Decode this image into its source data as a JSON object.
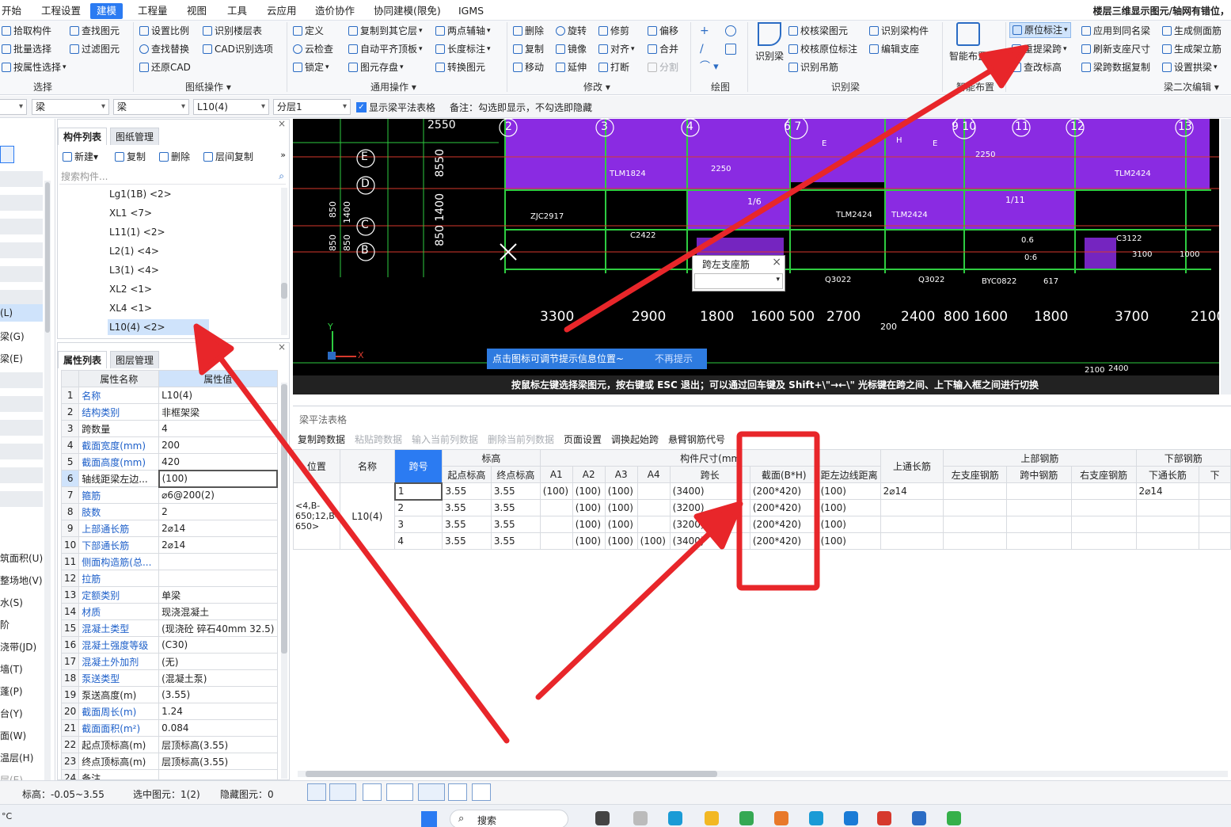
{
  "menu": {
    "items": [
      "开始",
      "工程设置",
      "建模",
      "工程量",
      "视图",
      "工具",
      "云应用",
      "造价协作",
      "协同建模(限免)",
      "IGMS"
    ],
    "active_index": 2,
    "right_info": "楼层三维显示图元/轴网有错位，"
  },
  "ribbon": {
    "select": {
      "items": [
        "拾取构件",
        "批量选择",
        "按属性选择"
      ],
      "items2": [
        "查找图元",
        "过滤图元"
      ],
      "group": "选择"
    },
    "drawing_ops": {
      "items": [
        "设置比例",
        "查找替换",
        "还原CAD"
      ],
      "items2": [
        "识别楼层表",
        "CAD识别选项"
      ],
      "group": "图纸操作"
    },
    "common_ops": {
      "items": [
        "定义",
        "云检查",
        "锁定"
      ],
      "items2": [
        "复制到其它层",
        "自动平齐顶板",
        "图元存盘"
      ],
      "items3": [
        "两点辅轴",
        "长度标注",
        "转换图元"
      ],
      "group": "通用操作"
    },
    "modify": {
      "items": [
        "删除",
        "复制",
        "移动"
      ],
      "items2": [
        "旋转",
        "镜像",
        "延伸"
      ],
      "items3": [
        "修剪",
        "对齐",
        "打断"
      ],
      "items4": [
        "偏移",
        "合并",
        "分割"
      ],
      "group": "修改"
    },
    "draw": {
      "group": "绘图"
    },
    "recognize": {
      "big": "识别梁",
      "items": [
        "校核梁图元",
        "校核原位标注",
        "识别吊筋"
      ],
      "items2": [
        "识别梁构件",
        "编辑支座"
      ],
      "group": "识别梁"
    },
    "smart": {
      "big": "智能布置",
      "group": "智能布置"
    },
    "secondary": {
      "items": [
        "原位标注",
        "重提梁跨",
        "查改标高"
      ],
      "items2": [
        "应用到同名梁",
        "刷新支座尺寸",
        "梁跨数据复制"
      ],
      "items3": [
        "生成侧面筋",
        "生成架立筋",
        "设置拱梁"
      ],
      "group": "梁二次编辑"
    }
  },
  "filterbar": {
    "floor": "",
    "type": "梁",
    "type2": "梁",
    "component": "L10(4)",
    "layer": "分层1",
    "checkbox_label": "显示梁平法表格",
    "note": "备注：勾选即显示，不勾选即隐藏"
  },
  "leftstrip": {
    "items": [
      "(L)",
      "梁(G)",
      "梁(E)",
      "筑面积(U)",
      "整场地(V)",
      "水(S)",
      "阶",
      "浇带(JD)",
      "墙(T)",
      "蓬(P)",
      "台(Y)",
      "面(W)",
      "温层(H)",
      "层(E)"
    ]
  },
  "component_list": {
    "tabs": [
      "构件列表",
      "图纸管理"
    ],
    "toolbar": {
      "new": "新建",
      "copy": "复制",
      "delete": "删除",
      "floor_copy": "层间复制"
    },
    "search_placeholder": "搜索构件...",
    "items": [
      "Lg1(1B) <2>",
      "XL1 <7>",
      "L11(1) <2>",
      "L2(1) <4>",
      "L3(1) <4>",
      "XL2 <1>",
      "XL4 <1>",
      "L10(4) <2>"
    ],
    "selected_index": 7
  },
  "property_list": {
    "tabs": [
      "属性列表",
      "图层管理"
    ],
    "headers": [
      "属性名称",
      "属性值"
    ],
    "rows": [
      {
        "n": "1",
        "k": "名称",
        "v": "L10(4)",
        "blue": true
      },
      {
        "n": "2",
        "k": "结构类别",
        "v": "非框架梁",
        "blue": true
      },
      {
        "n": "3",
        "k": "跨数量",
        "v": "4",
        "blue": false
      },
      {
        "n": "4",
        "k": "截面宽度(mm)",
        "v": "200",
        "blue": true
      },
      {
        "n": "5",
        "k": "截面高度(mm)",
        "v": "420",
        "blue": true
      },
      {
        "n": "6",
        "k": "轴线距梁左边...",
        "v": "(100)",
        "blue": false
      },
      {
        "n": "7",
        "k": "箍筋",
        "v": "⌀6@200(2)",
        "blue": true
      },
      {
        "n": "8",
        "k": "肢数",
        "v": "2",
        "blue": true
      },
      {
        "n": "9",
        "k": "上部通长筋",
        "v": "2⌀14",
        "blue": true
      },
      {
        "n": "10",
        "k": "下部通长筋",
        "v": "2⌀14",
        "blue": true
      },
      {
        "n": "11",
        "k": "侧面构造筋(总...",
        "v": "",
        "blue": true
      },
      {
        "n": "12",
        "k": "拉筋",
        "v": "",
        "blue": true
      },
      {
        "n": "13",
        "k": "定额类别",
        "v": "单梁",
        "blue": true
      },
      {
        "n": "14",
        "k": "材质",
        "v": "现浇混凝土",
        "blue": true
      },
      {
        "n": "15",
        "k": "混凝土类型",
        "v": "(现浇砼 碎石40mm 32.5)",
        "blue": true
      },
      {
        "n": "16",
        "k": "混凝土强度等级",
        "v": "(C30)",
        "blue": true
      },
      {
        "n": "17",
        "k": "混凝土外加剂",
        "v": "(无)",
        "blue": true
      },
      {
        "n": "18",
        "k": "泵送类型",
        "v": "(混凝土泵)",
        "blue": true
      },
      {
        "n": "19",
        "k": "泵送高度(m)",
        "v": "(3.55)",
        "blue": false
      },
      {
        "n": "20",
        "k": "截面周长(m)",
        "v": "1.24",
        "blue": true
      },
      {
        "n": "21",
        "k": "截面面积(m²)",
        "v": "0.084",
        "blue": true
      },
      {
        "n": "22",
        "k": "起点顶标高(m)",
        "v": "层顶标高(3.55)",
        "blue": false
      },
      {
        "n": "23",
        "k": "终点顶标高(m)",
        "v": "层顶标高(3.55)",
        "blue": false
      },
      {
        "n": "24",
        "k": "备注",
        "v": "",
        "blue": false
      }
    ],
    "selected_row": 5
  },
  "cad": {
    "dims_bottom": [
      "3300",
      "2900",
      "1800",
      "1600 500",
      "2700",
      "2400",
      "800 1600",
      "1800",
      "3700",
      "2100"
    ],
    "axes_top": [
      "2",
      "3",
      "4",
      "6 7",
      "9 10",
      "11",
      "12",
      "13"
    ],
    "axes_left": [
      "E",
      "D",
      "C",
      "B"
    ],
    "dims_left": [
      "2550",
      "8550",
      "850 1400",
      "850",
      "1400",
      "850",
      "850"
    ],
    "labels": [
      "TLM1824",
      "TLM2424",
      "TLM2424",
      "TLM2424",
      "C2422",
      "C3122",
      "Q3022",
      "Q3022",
      "BYC0822",
      "ZJC2917",
      "H",
      "E",
      "E",
      "2250",
      "2250",
      "1/6",
      "1/11",
      "0.6",
      "0:6",
      "617",
      "200",
      "2400",
      "2100",
      "3100",
      "1000"
    ],
    "hint": "点击图标可调节提示信息位置~",
    "hint_dismiss": "不再提示",
    "instruction": "按鼠标左键选择梁图元，按右键或 ESC 退出；可以通过回车键及 Shift+\\\"→←\\\" 光标键在跨之间、上下输入框之间进行切换",
    "popup_title": "跨左支座筋"
  },
  "beam_table": {
    "title": "梁平法表格",
    "toolbar": [
      "复制跨数据",
      "粘贴跨数据",
      "输入当前列数据",
      "删除当前列数据",
      "页面设置",
      "调换起始跨",
      "悬臂钢筋代号"
    ],
    "toolbar_disabled": [
      false,
      true,
      true,
      true,
      false,
      false,
      false
    ],
    "group_headers": [
      "标高",
      "构件尺寸(mm",
      "上部钢筋",
      "下部钢筋"
    ],
    "headers": [
      "位置",
      "名称",
      "跨号",
      "起点标高",
      "终点标高",
      "A1",
      "A2",
      "A3",
      "A4",
      "跨长",
      "截面(B*H)",
      "距左边线距离",
      "上通长筋",
      "左支座钢筋",
      "跨中钢筋",
      "右支座钢筋",
      "下通长筋",
      "下"
    ],
    "position": "<4,B-650;12,B-650>",
    "name": "L10(4)",
    "rows": [
      [
        "1",
        "3.55",
        "3.55",
        "(100)",
        "(100)",
        "(100)",
        "",
        "(3400)",
        "(200*420)",
        "(100)",
        "2⌀14",
        "",
        "",
        "",
        "2⌀14"
      ],
      [
        "2",
        "3.55",
        "3.55",
        "",
        "(100)",
        "(100)",
        "",
        "(3200)",
        "(200*420)",
        "(100)",
        "",
        "",
        "",
        "",
        ""
      ],
      [
        "3",
        "3.55",
        "3.55",
        "",
        "(100)",
        "(100)",
        "",
        "(3200)",
        "(200*420)",
        "(100)",
        "",
        "",
        "",
        "",
        ""
      ],
      [
        "4",
        "3.55",
        "3.55",
        "",
        "(100)",
        "(100)",
        "(100)",
        "(3400)",
        "(200*420)",
        "(100)",
        "",
        "",
        "",
        "",
        ""
      ]
    ]
  },
  "statusbar": {
    "elevation": "标高：-0.05~3.55",
    "selected": "选中图元：1(2)",
    "hidden": "隐藏图元：0"
  },
  "taskbar": {
    "search": "搜索",
    "temp": "°C"
  },
  "colors": {
    "accent": "#2b7bf2",
    "cad_room": "#8a2be2",
    "cad_wall": "#2ecc40",
    "annotation": "#e8262a"
  }
}
